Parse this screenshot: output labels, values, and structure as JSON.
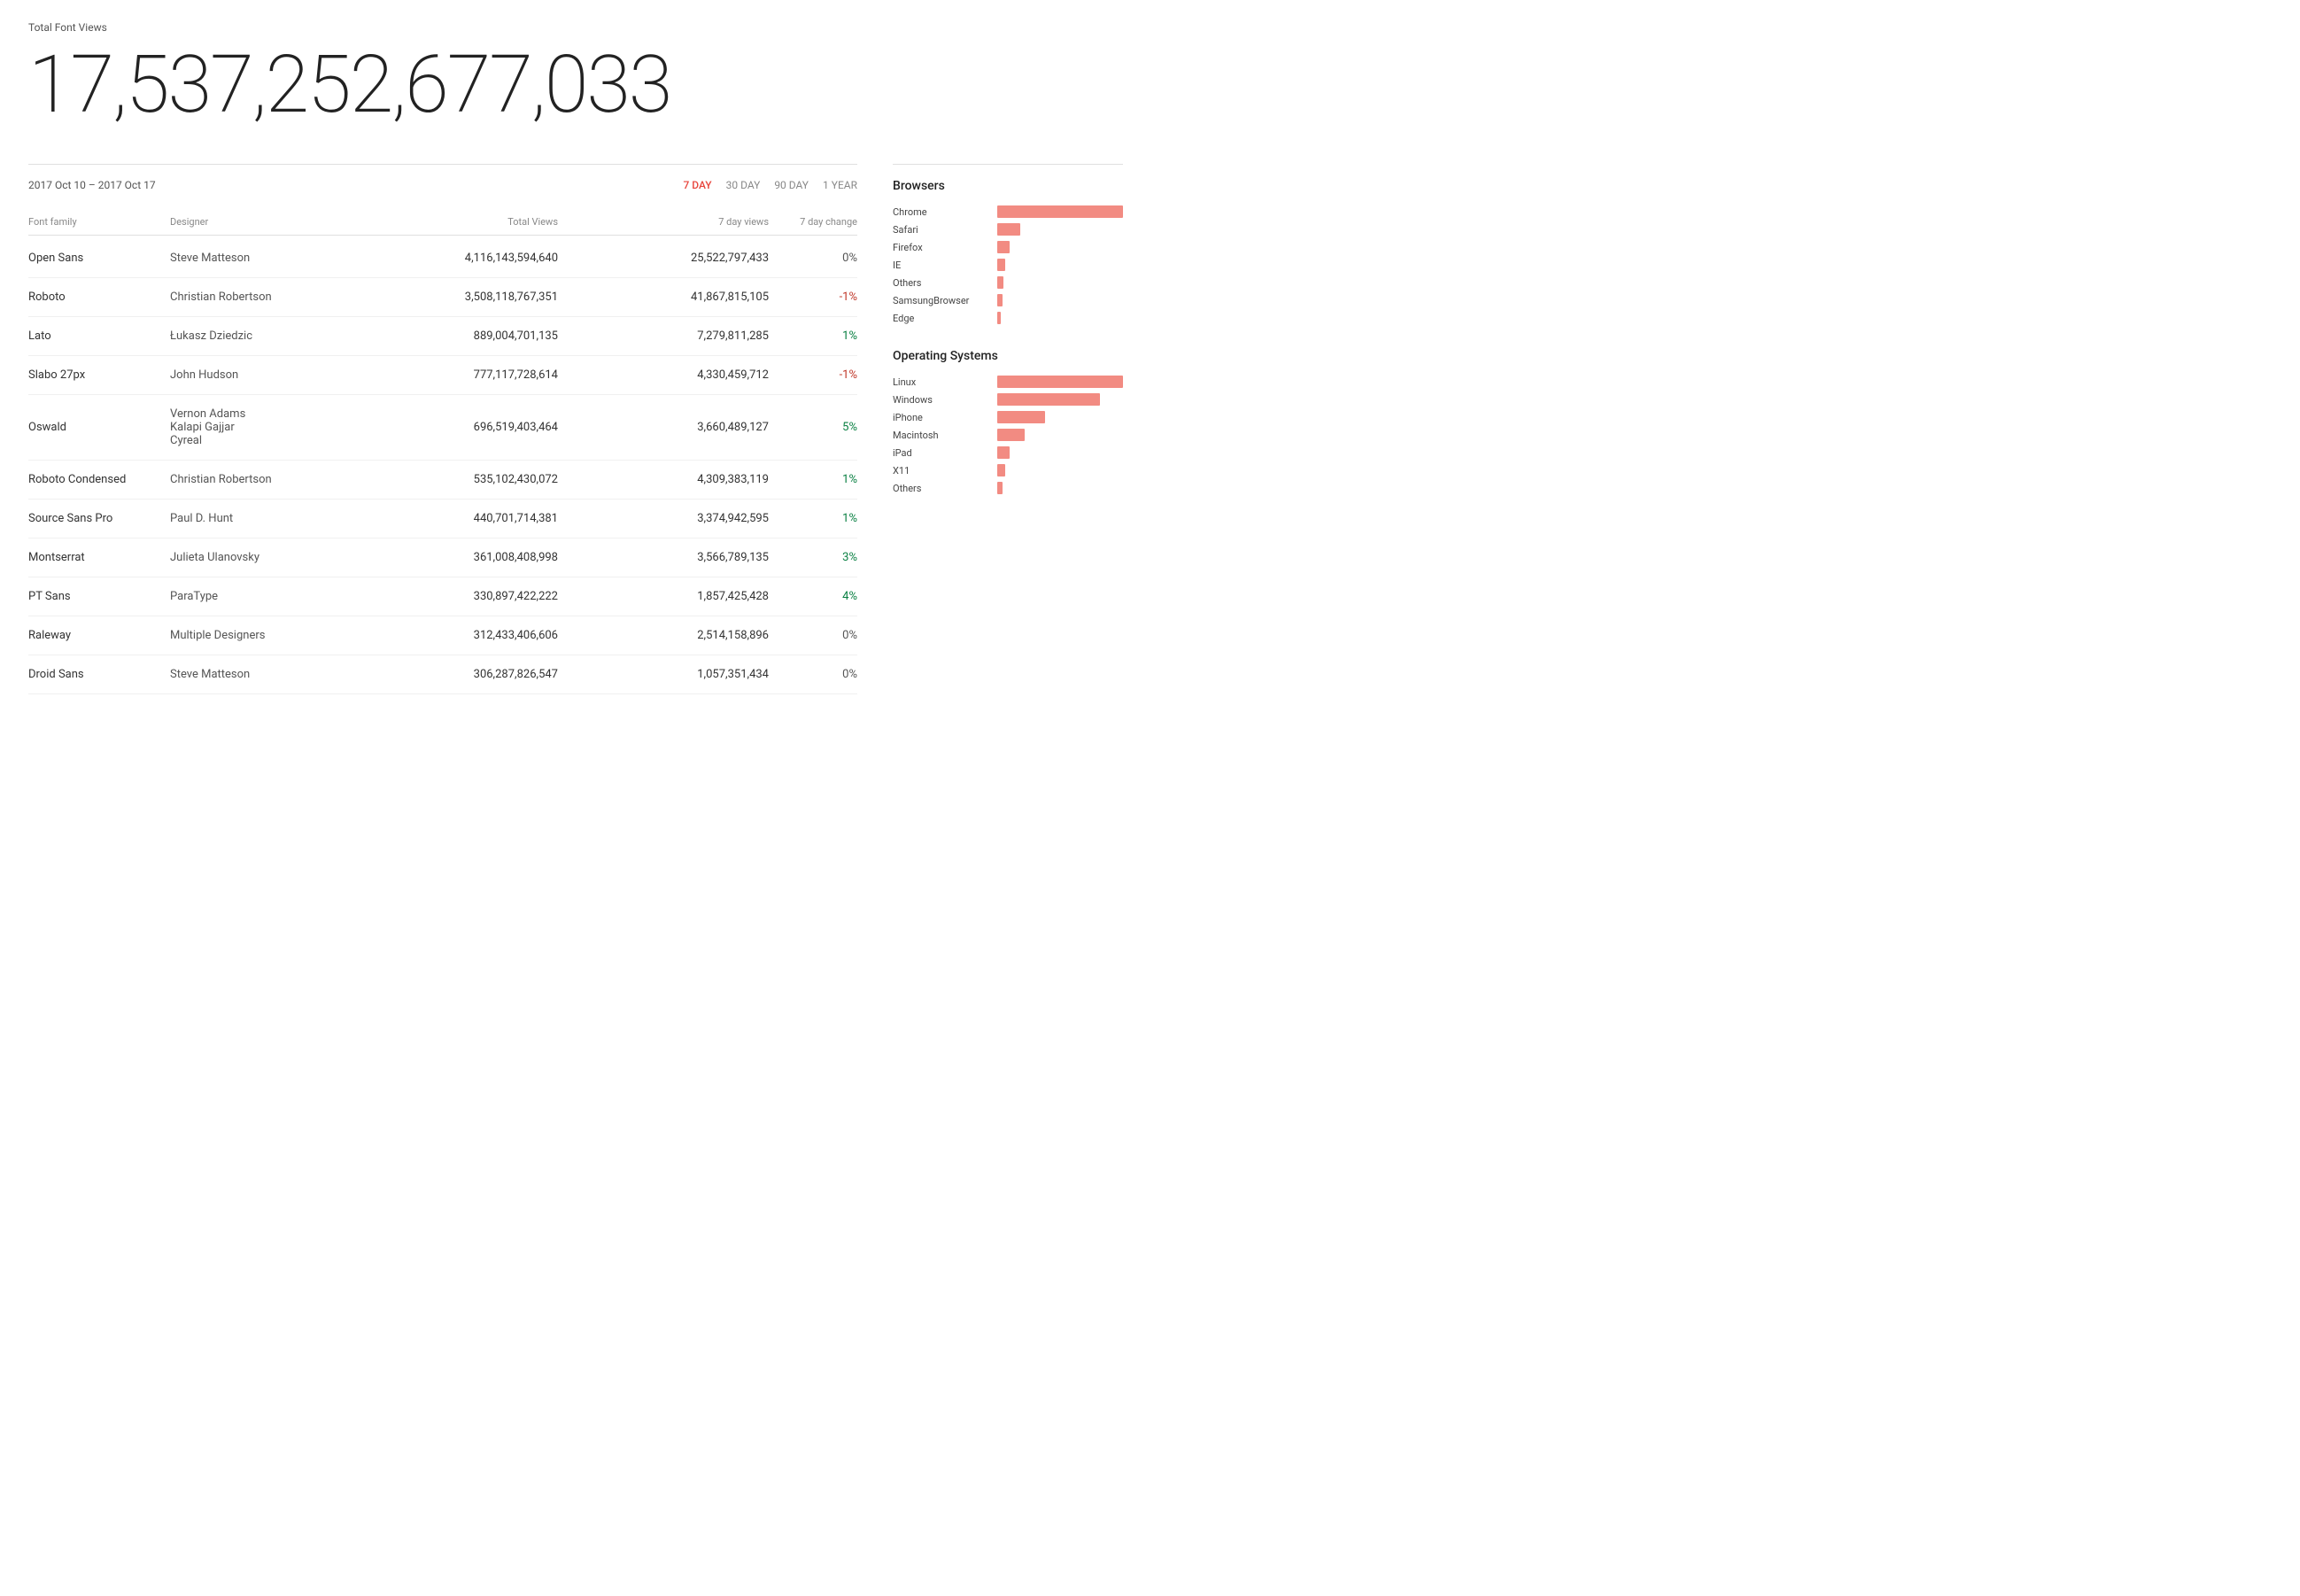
{
  "header": {
    "total_label": "Total Font Views",
    "total_number": "17,537,252,677,033"
  },
  "date_range": "2017 Oct 10 – 2017 Oct 17",
  "time_filters": [
    {
      "label": "7 DAY",
      "active": true
    },
    {
      "label": "30 DAY",
      "active": false
    },
    {
      "label": "90 DAY",
      "active": false
    },
    {
      "label": "1 YEAR",
      "active": false
    }
  ],
  "table": {
    "columns": [
      {
        "label": "Font family",
        "align": "left"
      },
      {
        "label": "Designer",
        "align": "left"
      },
      {
        "label": "Total Views",
        "align": "right"
      },
      {
        "label": "7 day views",
        "align": "right"
      },
      {
        "label": "7 day change",
        "align": "right"
      }
    ],
    "rows": [
      {
        "font": "Open Sans",
        "designer": "Steve Matteson",
        "total": "4,116,143,594,640",
        "views7": "25,522,797,433",
        "change": "0%",
        "change_class": "change-neutral"
      },
      {
        "font": "Roboto",
        "designer": "Christian Robertson",
        "total": "3,508,118,767,351",
        "views7": "41,867,815,105",
        "change": "-1%",
        "change_class": "change-negative"
      },
      {
        "font": "Lato",
        "designer": "Łukasz Dziedzic",
        "total": "889,004,701,135",
        "views7": "7,279,811,285",
        "change": "1%",
        "change_class": "change-positive"
      },
      {
        "font": "Slabo 27px",
        "designer": "John Hudson",
        "total": "777,117,728,614",
        "views7": "4,330,459,712",
        "change": "-1%",
        "change_class": "change-negative"
      },
      {
        "font": "Oswald",
        "designer": "Vernon Adams\nKalapi Gajjar\nCyreal",
        "total": "696,519,403,464",
        "views7": "3,660,489,127",
        "change": "5%",
        "change_class": "change-positive"
      },
      {
        "font": "Roboto Condensed",
        "designer": "Christian Robertson",
        "total": "535,102,430,072",
        "views7": "4,309,383,119",
        "change": "1%",
        "change_class": "change-positive"
      },
      {
        "font": "Source Sans Pro",
        "designer": "Paul D. Hunt",
        "total": "440,701,714,381",
        "views7": "3,374,942,595",
        "change": "1%",
        "change_class": "change-positive"
      },
      {
        "font": "Montserrat",
        "designer": "Julieta Ulanovsky",
        "total": "361,008,408,998",
        "views7": "3,566,789,135",
        "change": "3%",
        "change_class": "change-positive"
      },
      {
        "font": "PT Sans",
        "designer": "ParaType",
        "total": "330,897,422,222",
        "views7": "1,857,425,428",
        "change": "4%",
        "change_class": "change-positive"
      },
      {
        "font": "Raleway",
        "designer": "Multiple Designers",
        "total": "312,433,406,606",
        "views7": "2,514,158,896",
        "change": "0%",
        "change_class": "change-neutral"
      },
      {
        "font": "Droid Sans",
        "designer": "Steve Matteson",
        "total": "306,287,826,547",
        "views7": "1,057,351,434",
        "change": "0%",
        "change_class": "change-neutral"
      }
    ]
  },
  "browsers": {
    "title": "Browsers",
    "items": [
      {
        "label": "Chrome",
        "value": 100
      },
      {
        "label": "Safari",
        "value": 18
      },
      {
        "label": "Firefox",
        "value": 10
      },
      {
        "label": "IE",
        "value": 6
      },
      {
        "label": "Others",
        "value": 5
      },
      {
        "label": "SamsungBrowser",
        "value": 4
      },
      {
        "label": "Edge",
        "value": 3
      }
    ]
  },
  "os": {
    "title": "Operating Systems",
    "items": [
      {
        "label": "Linux",
        "value": 100
      },
      {
        "label": "Windows",
        "value": 82
      },
      {
        "label": "iPhone",
        "value": 38
      },
      {
        "label": "Macintosh",
        "value": 22
      },
      {
        "label": "iPad",
        "value": 10
      },
      {
        "label": "X11",
        "value": 6
      },
      {
        "label": "Others",
        "value": 4
      }
    ]
  }
}
